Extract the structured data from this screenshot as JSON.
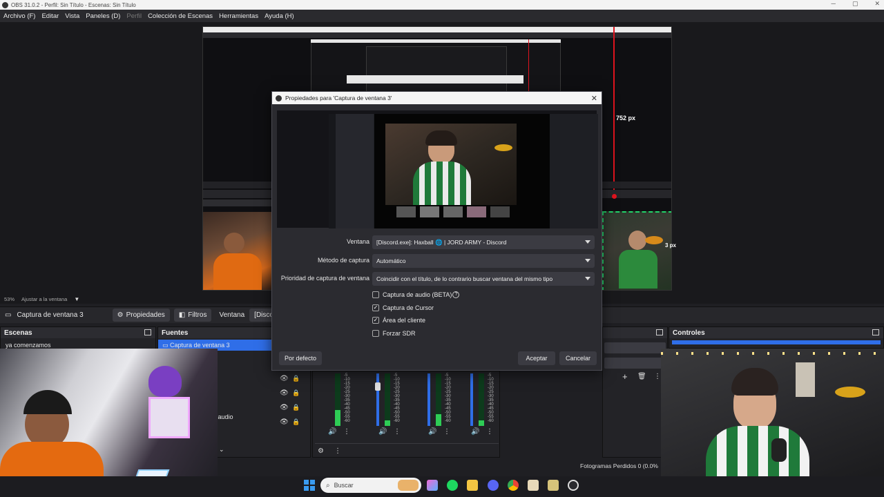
{
  "window": {
    "title": "OBS 31.0.2 - Perfil: Sin Título - Escenas: Sin Título",
    "controls": [
      "─",
      "▢",
      "✕"
    ]
  },
  "menu": [
    {
      "label": "Archivo (F)",
      "enabled": true
    },
    {
      "label": "Editar",
      "enabled": true
    },
    {
      "label": "Vista",
      "enabled": true
    },
    {
      "label": "Paneles (D)",
      "enabled": true
    },
    {
      "label": "Perfil",
      "enabled": false
    },
    {
      "label": "Colección de Escenas",
      "enabled": true
    },
    {
      "label": "Herramientas",
      "enabled": true
    },
    {
      "label": "Ayuda (H)",
      "enabled": true
    }
  ],
  "preview": {
    "size_label": "752 px",
    "side_label": "3 px",
    "zoom": "53%",
    "fit": "Ajustar a la ventana"
  },
  "source_toolbar": {
    "source_name": "Captura de ventana 3",
    "properties": "Propiedades",
    "filters": "Filtros",
    "window_label": "Ventana",
    "window_value": "[Discord.exe]: I"
  },
  "docks": {
    "scenes": {
      "title": "Escenas",
      "items": [
        "ya comenzamos"
      ]
    },
    "sources": {
      "title": "Fuentes",
      "items": [
        "Captura de ventana 3"
      ],
      "partial_label": "da audio"
    },
    "controls": {
      "title": "Controles"
    }
  },
  "dialog": {
    "title": "Propiedades para 'Captura de ventana 3'",
    "fields": [
      {
        "label": "Ventana",
        "value": "[Discord.exe]: Haxball 🌐 | JORD ARMY - Discord"
      },
      {
        "label": "Método de captura",
        "value": "Automático"
      },
      {
        "label": "Prioridad de captura de ventana",
        "value": "Coincidir con el título, de lo contrario buscar ventana del mismo tipo"
      }
    ],
    "checkboxes": [
      {
        "label": "Captura de audio (BETA)",
        "checked": false,
        "help": "?"
      },
      {
        "label": "Captura de Cursor",
        "checked": true
      },
      {
        "label": "Área del cliente",
        "checked": true
      },
      {
        "label": "Forzar SDR",
        "checked": false
      }
    ],
    "buttons": {
      "defaults": "Por defecto",
      "accept": "Aceptar",
      "cancel": "Cancelar"
    }
  },
  "mixer": {
    "scale": [
      "-5",
      "-10",
      "-15",
      "-20",
      "-25",
      "-30",
      "-35",
      "-40",
      "-45",
      "-50",
      "-55",
      "-60"
    ],
    "channels": [
      {
        "level": 0.3
      },
      {
        "level": 0.1
      },
      {
        "level": 0.22
      },
      {
        "level": 0.1
      }
    ]
  },
  "status": {
    "dropped_frames": "Fotogramas Perdidos 0 (0.0%"
  },
  "taskbar": {
    "search_placeholder": "Buscar"
  },
  "colors": {
    "accent": "#2f6ee8",
    "red_guide": "#e0141e",
    "green_guide": "#22d46a",
    "meter_green": "#2ecc55"
  }
}
